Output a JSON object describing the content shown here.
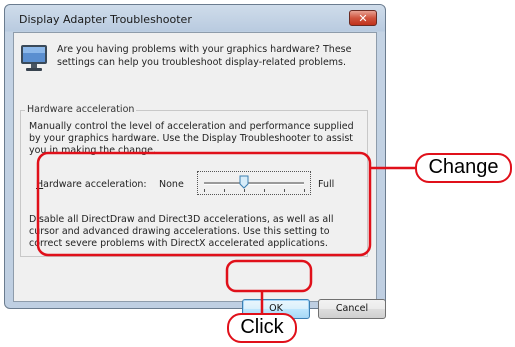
{
  "window": {
    "title": "Display Adapter Troubleshooter",
    "close_glyph": "✕"
  },
  "intro": {
    "icon": "monitor-icon",
    "text": "Are you having problems with your graphics hardware? These settings can help you troubleshoot display-related problems."
  },
  "hardware_group": {
    "title": "Hardware acceleration",
    "description": "Manually control the level of acceleration and performance supplied by your graphics hardware. Use the Display Troubleshooter to assist you in making the change.",
    "slider_label_prefix": "H",
    "slider_label_rest": "ardware acceleration:",
    "min_label": "None",
    "max_label": "Full",
    "slider_level_fraction": 0.4,
    "note": "Disable all DirectDraw and Direct3D accelerations, as well as all cursor and advanced drawing accelerations. Use this setting to correct severe problems with DirectX accelerated applications."
  },
  "buttons": {
    "ok": "OK",
    "cancel": "Cancel"
  },
  "annotations": {
    "change": "Change",
    "click": "Click",
    "highlight_color": "#e0101a"
  }
}
